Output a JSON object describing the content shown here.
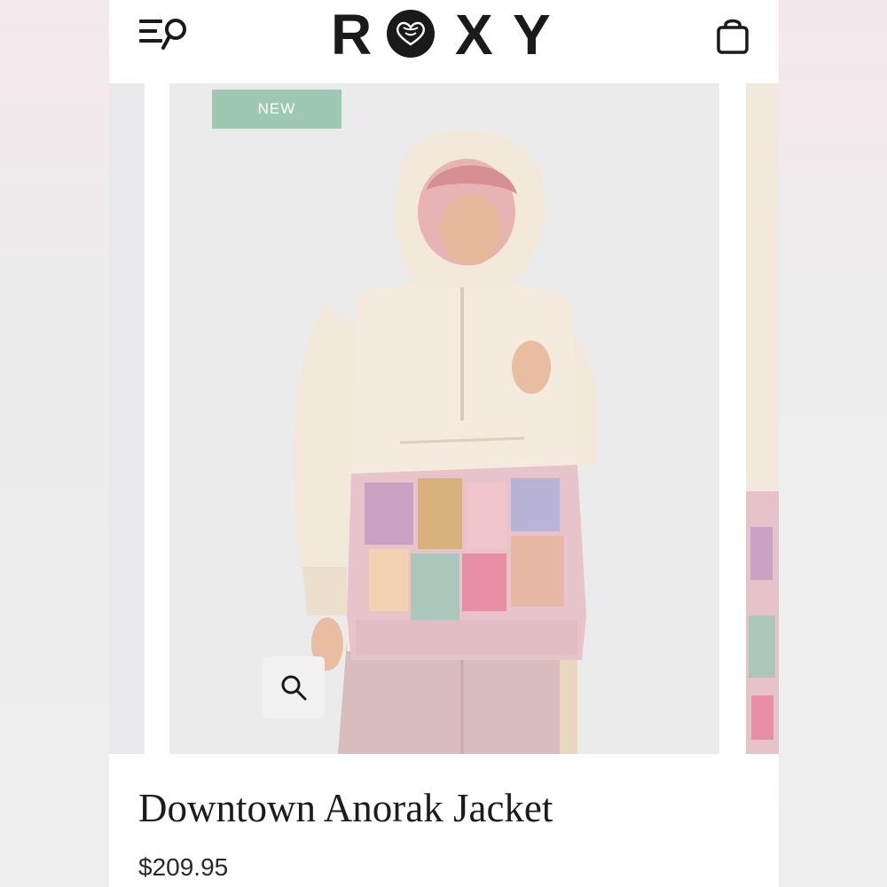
{
  "brand": {
    "logo_text": "ROXY",
    "logo_letters": [
      "R",
      "",
      "X",
      "Y"
    ]
  },
  "header": {
    "menu_icon": "menu-search-icon",
    "bag_icon": "shopping-bag-icon"
  },
  "gallery": {
    "badge_label": "NEW",
    "zoom_icon": "magnifier-icon",
    "image_description_icon": "product-photo"
  },
  "product": {
    "title": "Downtown Anorak Jacket",
    "price": "$209.95"
  },
  "colors": {
    "badge": "#9ec8b2",
    "text": "#1c1c1c",
    "photo_background": "#ebebec"
  }
}
